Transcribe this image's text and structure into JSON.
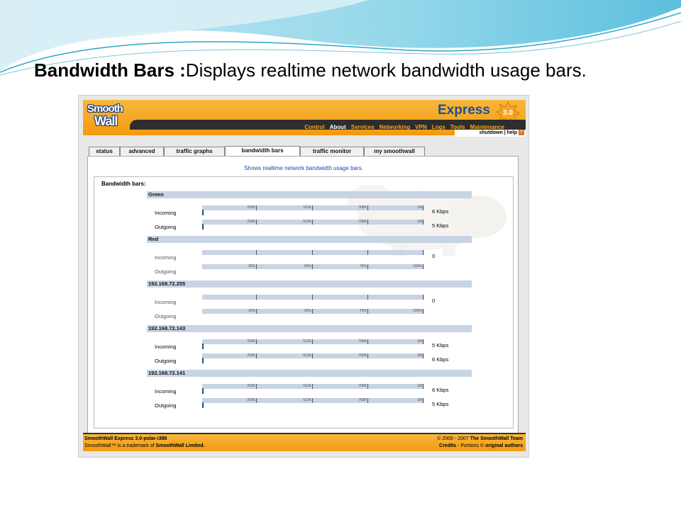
{
  "slide": {
    "title_bold": "Bandwidth Bars :",
    "title_rest": "Displays realtime network bandwidth usage bars."
  },
  "app": {
    "logo_line1": "Smooth",
    "logo_line2": "Wall",
    "product": "Express",
    "version_badge": "3.0",
    "brand_colors": {
      "orange": "#f39a10",
      "nav_dark": "#2d2d2d",
      "bar_blue": "#c8d4e4",
      "link_blue": "#2244aa"
    },
    "nav": [
      "Control",
      "About",
      "Services",
      "Networking",
      "VPN",
      "Logs",
      "Tools",
      "Maintenance"
    ],
    "nav_active": "About",
    "subnav": {
      "shutdown": "shutdown",
      "separator": "|",
      "help": "help",
      "help_icon": "?"
    }
  },
  "tabs": [
    {
      "label": "status"
    },
    {
      "label": "advanced"
    },
    {
      "label": "traffic graphs"
    },
    {
      "label": "bandwidth bars",
      "active": true
    },
    {
      "label": "traffic monitor"
    },
    {
      "label": "my smoothwall"
    }
  ],
  "page": {
    "description": "Shows realtime network bandwidth usage bars.",
    "panel_title": "Bandwidth bars:"
  },
  "groups": [
    {
      "name": "Green",
      "rows": [
        {
          "label": "Incoming",
          "value": "6 Kbps",
          "scale": [
            "256K",
            "512K",
            "768K",
            "1M"
          ]
        },
        {
          "label": "Outgoing",
          "value": "5 Kbps",
          "scale": [
            "256K",
            "512K",
            "768K",
            "1M"
          ]
        }
      ]
    },
    {
      "name": "Red",
      "rows": [
        {
          "label": "Incoming",
          "value": "0",
          "scale": [
            "",
            "",
            "",
            ""
          ],
          "dim": true
        },
        {
          "label": "Outgoing",
          "value": "",
          "scale": [
            "25%",
            "50%",
            "75%",
            "100%"
          ],
          "dim": true
        }
      ]
    },
    {
      "name": "192.168.72.255",
      "rows": [
        {
          "label": "Incoming",
          "value": "0",
          "scale": [
            "",
            "",
            "",
            ""
          ],
          "dim": true
        },
        {
          "label": "Outgoing",
          "value": "",
          "scale": [
            "25%",
            "50%",
            "75%",
            "100%"
          ],
          "dim": true
        }
      ]
    },
    {
      "name": "192.168.72.143",
      "rows": [
        {
          "label": "Incoming",
          "value": "5 Kbps",
          "scale": [
            "256K",
            "512K",
            "768K",
            "1M"
          ]
        },
        {
          "label": "Outgoing",
          "value": "6 Kbps",
          "scale": [
            "256K",
            "512K",
            "768K",
            "1M"
          ]
        }
      ]
    },
    {
      "name": "192.168.72.141",
      "rows": [
        {
          "label": "Incoming",
          "value": "6 Kbps",
          "scale": [
            "256K",
            "512K",
            "768K",
            "1M"
          ]
        },
        {
          "label": "Outgoing",
          "value": "5 Kbps",
          "scale": [
            "256K",
            "512K",
            "768K",
            "1M"
          ]
        }
      ]
    }
  ],
  "footer": {
    "version_line": "SmoothWall Express 3.0-polar-i386",
    "trademark_pre": "SmoothWall™ is a trademark of ",
    "trademark_company": "SmoothWall Limited.",
    "copyright_pre": "© 2000 - 2007 ",
    "copyright_team": "The SmoothWall Team",
    "credits": "Credits",
    "portions_pre": " - Portions © ",
    "portions_authors": "original authors"
  }
}
